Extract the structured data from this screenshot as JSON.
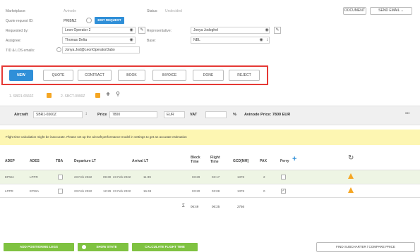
{
  "form": {
    "marketplace_label": "Marketplace:",
    "marketplace_value": "Avinode",
    "status_label": "Status:",
    "status_value": "Undecided",
    "quote_id_label": "Quote request ID:",
    "quote_id_value": "PRIBNZ",
    "edit_request": "EDIT REQUEST",
    "requested_by_label": "Requested by:",
    "requested_by_value": "Leon Operator 2",
    "representative_label": "Representative:",
    "representative_value": "Jonya Jodoghel",
    "assignee_label": "Assignee:",
    "assignee_value": "Thomas Delta",
    "base_label": "Base:",
    "base_value": "NBL",
    "tdl_label": "T/D & LOS emails:",
    "tdl_value": "Jonya.Jod@LeonOperatorDabo"
  },
  "top_buttons": {
    "document": "DOCUMENT",
    "send_email": "SEND EMAIL ⌄"
  },
  "states": [
    "NEW",
    "QUOTE",
    "CONTRACT",
    "BOOK",
    "INVOICE",
    "DONE",
    "REJECT"
  ],
  "tabs": [
    "1. SBR1-6560Z",
    "2. SBCT-0990Z"
  ],
  "aircraft_bar": {
    "aircraft_label": "Aircraft",
    "aircraft_value": "SBR1-6560Z",
    "price_label": "Price",
    "price_value": "7800",
    "currency": "EUR",
    "vat_label": "VAT",
    "percent": "%",
    "avinode_price": "Avinode Price: 7800 EUR",
    "more": "•••"
  },
  "warning": "Flight time calculation might be inaccurate. Please set up the aircraft performance model in settings to get an accurate estimation",
  "table": {
    "headers": [
      "ADEP",
      "ADES",
      "TBA",
      "Departure LT",
      "Arrival LT",
      "Block Time",
      "Flight Time",
      "GCD[NM]",
      "PAX",
      "Ferry"
    ],
    "rows": [
      {
        "adep": "EPWA",
        "ades": "LPPR",
        "dep_date": "23 Feb 2022",
        "dep_time": "09:30",
        "arr_date": "23 Feb 2022",
        "arr_time": "11:39",
        "block": "03:29",
        "flight": "03:17",
        "gcd": "1378",
        "pax": "2"
      },
      {
        "adep": "LPPR",
        "ades": "EPWA",
        "dep_date": "23 Feb 2022",
        "dep_time": "12:29",
        "arr_date": "23 Feb 2022",
        "arr_time": "16:49",
        "block": "03:20",
        "flight": "03:08",
        "gcd": "1378",
        "pax": "0"
      }
    ],
    "totals": {
      "sigma": "Σ",
      "block": "06:49",
      "flight": "06:25",
      "gcd": "2756"
    }
  },
  "bottom_buttons": {
    "add_positioning": "ADD POSITIONING LEGS",
    "show_state": "SHOW STATE",
    "calculate": "CALCULATE FLIGHT TIME",
    "find_subcharter": "FIND SUBCHARTER / COMPARE PRICE"
  },
  "colors": {
    "accent": "#2f8fd8",
    "highlight": "#e53935",
    "warning_bg": "#fdf6b2",
    "row_highlight": "#eef5e4",
    "green": "#7fc241",
    "alert": "#f5a623"
  }
}
